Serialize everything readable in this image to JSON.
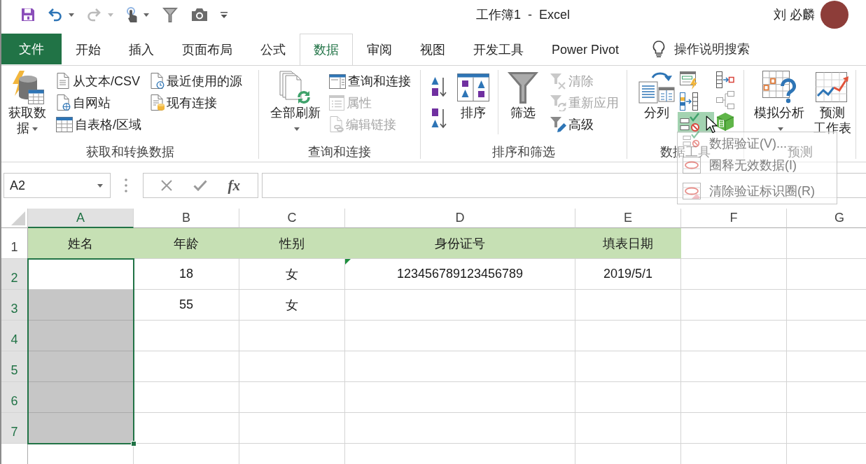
{
  "window": {
    "title": "工作簿1  -  Excel",
    "user": "刘 必麟"
  },
  "quick_access": [
    {
      "menu": false,
      "disabled": false
    },
    {
      "menu": true,
      "disabled": false
    },
    {
      "menu": true,
      "disabled": true
    },
    {
      "menu": true,
      "disabled": false
    },
    {
      "menu": false,
      "disabled": false
    },
    {
      "menu": false,
      "disabled": false
    },
    {
      "menu": false,
      "disabled": false
    }
  ],
  "tabs": [
    {
      "label": "文件",
      "kind": "file",
      "selected": false
    },
    {
      "label": "开始",
      "kind": "tab",
      "selected": false
    },
    {
      "label": "插入",
      "kind": "tab",
      "selected": false
    },
    {
      "label": "页面布局",
      "kind": "tab",
      "selected": false
    },
    {
      "label": "公式",
      "kind": "tab",
      "selected": false
    },
    {
      "label": "数据",
      "kind": "tab",
      "selected": true
    },
    {
      "label": "审阅",
      "kind": "tab",
      "selected": false
    },
    {
      "label": "视图",
      "kind": "tab",
      "selected": false
    },
    {
      "label": "开发工具",
      "kind": "tab",
      "selected": false
    },
    {
      "label": "Power Pivot",
      "kind": "tab",
      "selected": false
    }
  ],
  "tell_me": {
    "label": "操作说明搜索"
  },
  "ribbon": {
    "groups": [
      {
        "label": "获取和转换数据",
        "columns": [
          [
            {
              "kind": "large",
              "label": "获取数据",
              "menu": true,
              "disabled": false,
              "expanded": false
            }
          ],
          [
            {
              "kind": "small",
              "label": "从文本/CSV",
              "menu": false,
              "disabled": false,
              "expanded": false
            },
            {
              "kind": "small",
              "label": "自网站",
              "menu": false,
              "disabled": false,
              "expanded": false
            },
            {
              "kind": "small",
              "label": "自表格/区域",
              "menu": false,
              "disabled": false,
              "expanded": false
            }
          ],
          [
            {
              "kind": "small",
              "label": "最近使用的源",
              "menu": false,
              "disabled": false,
              "expanded": false
            },
            {
              "kind": "small",
              "label": "现有连接",
              "menu": false,
              "disabled": false,
              "expanded": false
            }
          ]
        ]
      },
      {
        "label": "查询和连接",
        "columns": [
          [
            {
              "kind": "large",
              "label": "全部刷新",
              "menu": true,
              "disabled": false,
              "expanded": false
            }
          ],
          [
            {
              "kind": "small",
              "label": "查询和连接",
              "menu": false,
              "disabled": false,
              "expanded": false
            },
            {
              "kind": "small",
              "label": "属性",
              "menu": false,
              "disabled": true,
              "expanded": false
            },
            {
              "kind": "small",
              "label": "编辑链接",
              "menu": false,
              "disabled": true,
              "expanded": false
            }
          ]
        ]
      },
      {
        "label": "排序和筛选",
        "columns": [
          [
            {
              "kind": "icon",
              "menu": false,
              "disabled": false,
              "expanded": false
            },
            {
              "kind": "icon",
              "menu": false,
              "disabled": false,
              "expanded": false
            }
          ],
          [
            {
              "kind": "large",
              "label": "排序",
              "menu": false,
              "disabled": false,
              "expanded": false
            }
          ],
          [
            {
              "kind": "large",
              "label": "筛选",
              "menu": false,
              "disabled": false,
              "expanded": false
            }
          ],
          [
            {
              "kind": "small",
              "label": "清除",
              "menu": false,
              "disabled": true,
              "expanded": false
            },
            {
              "kind": "small",
              "label": "重新应用",
              "menu": false,
              "disabled": true,
              "expanded": false
            },
            {
              "kind": "small",
              "label": "高级",
              "menu": false,
              "disabled": false,
              "expanded": false
            }
          ]
        ]
      },
      {
        "label": "数据工具",
        "columns": [
          [
            {
              "kind": "large",
              "label": "分列",
              "menu": false,
              "disabled": false,
              "expanded": false
            }
          ],
          [
            {
              "kind": "icon",
              "menu": false,
              "disabled": false,
              "expanded": false
            },
            {
              "kind": "icon",
              "menu": false,
              "disabled": false,
              "expanded": false
            },
            {
              "kind": "icon",
              "menu": true,
              "disabled": false,
              "expanded": true
            }
          ],
          [
            {
              "kind": "icon",
              "menu": false,
              "disabled": false,
              "expanded": false
            },
            {
              "kind": "icon",
              "menu": false,
              "disabled": false,
              "expanded": false
            },
            {
              "kind": "icon",
              "menu": false,
              "disabled": false,
              "expanded": false
            }
          ]
        ]
      },
      {
        "label": "预测",
        "columns": [
          [
            {
              "kind": "large",
              "label": "模拟分析",
              "menu": true,
              "disabled": false,
              "expanded": false
            }
          ],
          [
            {
              "kind": "large",
              "label": "预测工作表",
              "menu": false,
              "disabled": false,
              "expanded": false
            }
          ]
        ]
      }
    ]
  },
  "dropdown_menu": {
    "items": [
      {
        "label": "数据验证(V)..."
      },
      {
        "label": "圈释无效数据(I)"
      },
      {
        "label": "清除验证标识圈(R)"
      }
    ]
  },
  "name_box": {
    "value": "A2"
  },
  "formula_bar": {
    "insert_function": "fx"
  },
  "sheet": {
    "columns": [
      {
        "label": "A",
        "selected": true
      },
      {
        "label": "B",
        "selected": false
      },
      {
        "label": "C",
        "selected": false
      },
      {
        "label": "D",
        "selected": false
      },
      {
        "label": "E",
        "selected": false
      },
      {
        "label": "F",
        "selected": false
      },
      {
        "label": "G",
        "selected": false
      }
    ],
    "rows": [
      {
        "label": "1",
        "selected": false,
        "cells": [
          {
            "value": "姓名",
            "color": "#c6e0b4",
            "flagged": false
          },
          {
            "value": "年龄",
            "color": "#c6e0b4",
            "flagged": false
          },
          {
            "value": "性别",
            "color": "#c6e0b4",
            "flagged": false
          },
          {
            "value": "身份证号",
            "color": "#c6e0b4",
            "flagged": false
          },
          {
            "value": "填表日期",
            "color": "#c6e0b4",
            "flagged": false
          },
          {
            "flagged": false
          },
          {
            "flagged": false
          }
        ]
      },
      {
        "label": "2",
        "selected": true,
        "cells": [
          {
            "flagged": false
          },
          {
            "value": "18",
            "flagged": false
          },
          {
            "value": "女",
            "flagged": false
          },
          {
            "value": "123456789123456789",
            "flagged": true
          },
          {
            "value": "2019/5/1",
            "flagged": false
          },
          {
            "flagged": false
          },
          {
            "flagged": false
          }
        ]
      },
      {
        "label": "3",
        "selected": true,
        "cells": [
          {
            "flagged": false
          },
          {
            "value": "55",
            "flagged": false
          },
          {
            "value": "女",
            "flagged": false
          },
          {
            "flagged": false
          },
          {
            "flagged": false
          },
          {
            "flagged": false
          },
          {
            "flagged": false
          }
        ]
      },
      {
        "label": "4",
        "selected": true,
        "cells": [
          {
            "flagged": false
          },
          {
            "flagged": false
          },
          {
            "flagged": false
          },
          {
            "flagged": false
          },
          {
            "flagged": false
          },
          {
            "flagged": false
          },
          {
            "flagged": false
          }
        ]
      },
      {
        "label": "5",
        "selected": true,
        "cells": [
          {
            "flagged": false
          },
          {
            "flagged": false
          },
          {
            "flagged": false
          },
          {
            "flagged": false
          },
          {
            "flagged": false
          },
          {
            "flagged": false
          },
          {
            "flagged": false
          }
        ]
      },
      {
        "label": "6",
        "selected": true,
        "cells": [
          {
            "flagged": false
          },
          {
            "flagged": false
          },
          {
            "flagged": false
          },
          {
            "flagged": false
          },
          {
            "flagged": false
          },
          {
            "flagged": false
          },
          {
            "flagged": false
          }
        ]
      },
      {
        "label": "7",
        "selected": true,
        "cells": [
          {
            "flagged": false
          },
          {
            "flagged": false
          },
          {
            "flagged": false
          },
          {
            "flagged": false
          },
          {
            "flagged": false
          },
          {
            "flagged": false
          },
          {
            "flagged": false
          }
        ]
      }
    ]
  }
}
